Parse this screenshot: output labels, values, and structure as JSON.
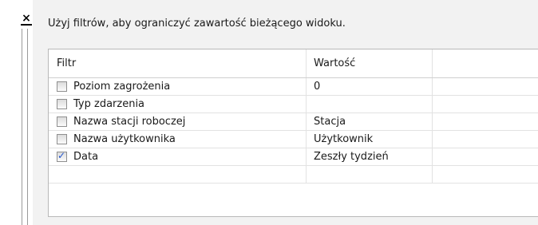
{
  "window": {
    "close_glyph": "×",
    "hint": "Użyj filtrów, aby ograniczyć zawartość bieżącego widoku."
  },
  "table": {
    "columns": [
      "Filtr",
      "Wartość",
      ""
    ],
    "rows": [
      {
        "label": "Poziom zagrożenia",
        "checked": false,
        "value": "0"
      },
      {
        "label": "Typ zdarzenia",
        "checked": false,
        "value": ""
      },
      {
        "label": "Nazwa stacji roboczej",
        "checked": false,
        "value": "Stacja"
      },
      {
        "label": "Nazwa użytkownika",
        "checked": false,
        "value": "Użytkownik"
      },
      {
        "label": "Data",
        "checked": true,
        "value": "Zeszły tydzień"
      },
      {
        "label": "",
        "checked": null,
        "value": ""
      }
    ]
  },
  "colors": {
    "panel_bg": "#f2f2f2",
    "grid_border": "#b8b8b8",
    "check_color": "#2255cc"
  }
}
